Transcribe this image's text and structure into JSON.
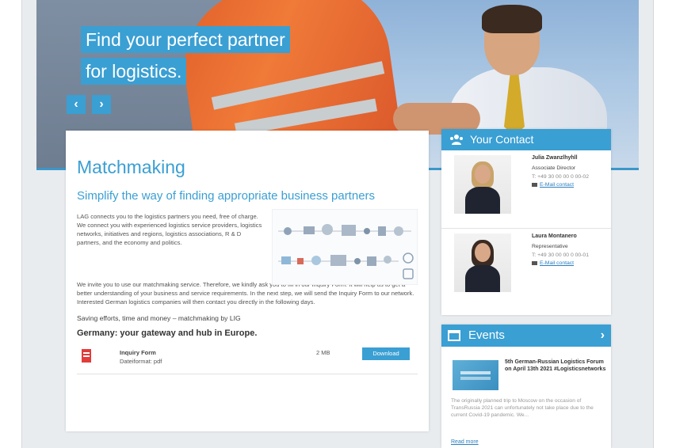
{
  "hero": {
    "headline_line1": "Find your perfect partner",
    "headline_line2": "for logistics.",
    "prev_label": "‹",
    "next_label": "›"
  },
  "main": {
    "title": "Matchmaking",
    "subtitle": "Simplify the way of finding appropriate business partners",
    "intro": "LAG connects you to the logistics partners you need, free of charge. We connect you with experienced logistics service providers, logistics networks, initiatives and regions, logistics associations, R & D partners, and the economy and politics.",
    "paragraph": "We invite you to use our matchmaking service. Therefore, we kindly ask you to fill in our Inquiry Form. It will help us to get a better understanding of your business and service requirements. In the next step, we will send the Inquiry Form to our network. Interested German logistics companies will then contact you directly in the following days.",
    "saving": "Saving efforts, time and money – matchmaking by LIG",
    "gateway": "Germany: your gateway and hub in Europe.",
    "download": {
      "name": "Inquiry Form",
      "file": "Dateiformat: pdf",
      "size": "2 MB",
      "button": "Download"
    }
  },
  "contact": {
    "title": "Your Contact",
    "people": [
      {
        "name": "Julia Zwanzlhyhll",
        "role": "Associate Director",
        "phone": "T: +49 30 00 00 0 00-02",
        "email": "E-Mail contact"
      },
      {
        "name": "Laura Montanero",
        "role": "Representative",
        "phone": "T: +49 30 00 00 0 00-01",
        "email": "E-Mail contact"
      }
    ]
  },
  "events": {
    "title": "Events",
    "chevron": "›",
    "item_title": "5th German-Russian Logistics Forum on April 13th 2021 #Logisticsnetworks",
    "item_desc": "The originally planned trip to Moscow on the occasion of TransRussia 2021 can unfortunately not take place due to the current Covid-19 pandemic. We...",
    "read_more": "Read more"
  },
  "colors": {
    "accent": "#3a9fd3",
    "link": "#2b7fbf",
    "pdf": "#e23b3b"
  }
}
